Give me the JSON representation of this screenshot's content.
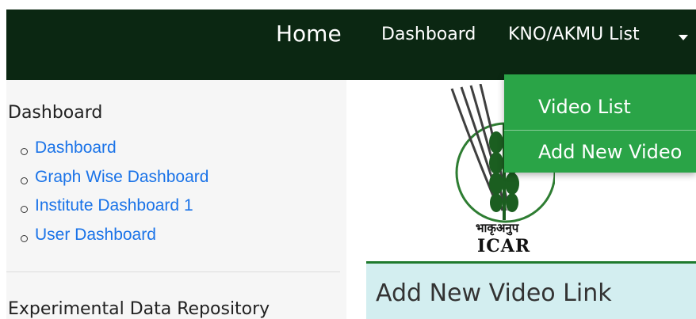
{
  "navbar": {
    "home_label": "Home",
    "dashboard_label": "Dashboard",
    "kno_label": "KNO/AKMU List",
    "bg_color": "#0b2712"
  },
  "dropdown": {
    "items": [
      {
        "label": "Video List"
      },
      {
        "label": "Add New Video"
      }
    ],
    "bg_color": "#2aa447"
  },
  "sidebar": {
    "sections": [
      {
        "heading": "Dashboard",
        "links": [
          {
            "label": "Dashboard"
          },
          {
            "label": "Graph Wise Dashboard"
          },
          {
            "label": "Institute Dashboard 1"
          },
          {
            "label": "User Dashboard"
          }
        ]
      },
      {
        "heading": "Experimental Data Repository"
      }
    ],
    "link_color": "#1a73e8"
  },
  "logo": {
    "hindi_text": "भाकृअनुप",
    "english_text": "ICAR"
  },
  "main": {
    "card_title": "Add New Video Link",
    "header_bg": "#d3eef0"
  }
}
